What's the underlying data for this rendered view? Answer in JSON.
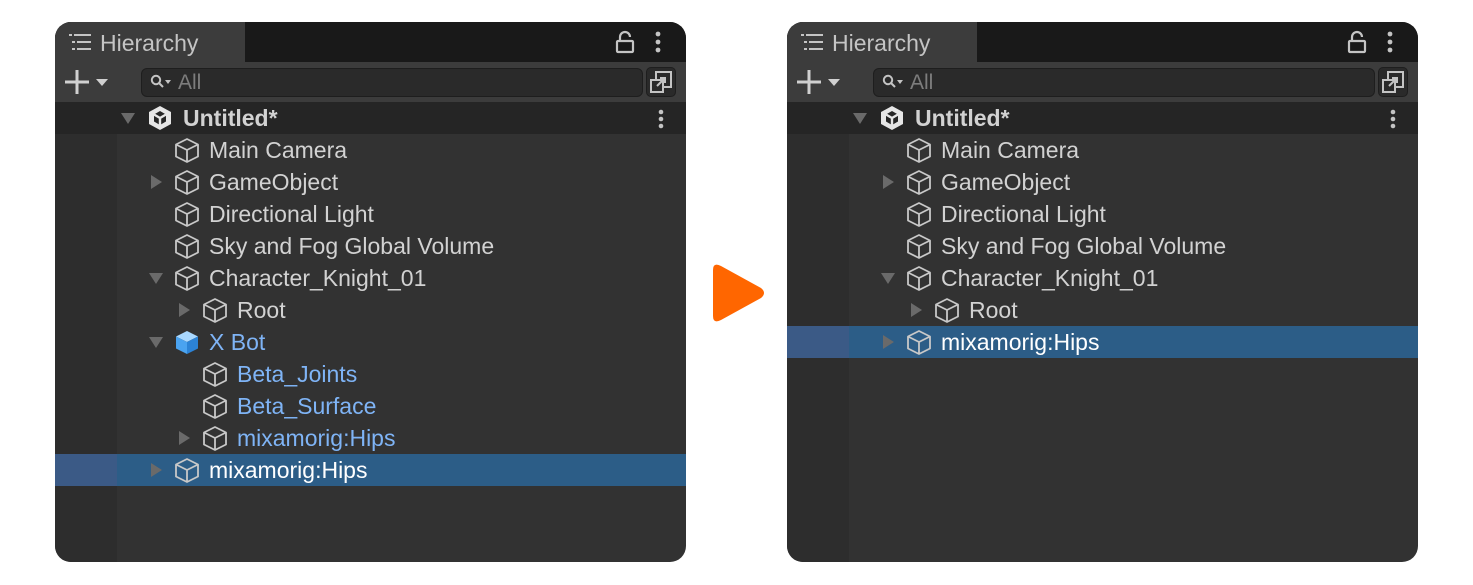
{
  "accent_color": "#ff6600",
  "selection_color": "#2c5d87",
  "prefab_text_color": "#7fb4f6",
  "panels": [
    {
      "tab_title": "Hierarchy",
      "search_placeholder": "All",
      "scene_name": "Untitled*",
      "rows": [
        {
          "label": "Main Camera",
          "icon": "cube-icon",
          "prefab": false,
          "fold": "none",
          "depth": 1,
          "selected": false
        },
        {
          "label": "GameObject",
          "icon": "cube-icon",
          "prefab": false,
          "fold": "collapsed",
          "depth": 1,
          "selected": false
        },
        {
          "label": "Directional Light",
          "icon": "cube-icon",
          "prefab": false,
          "fold": "none",
          "depth": 1,
          "selected": false
        },
        {
          "label": "Sky and Fog Global Volume",
          "icon": "cube-icon",
          "prefab": false,
          "fold": "none",
          "depth": 1,
          "selected": false
        },
        {
          "label": "Character_Knight_01",
          "icon": "cube-icon",
          "prefab": false,
          "fold": "expanded",
          "depth": 1,
          "selected": false
        },
        {
          "label": "Root",
          "icon": "cube-icon",
          "prefab": false,
          "fold": "collapsed",
          "depth": 2,
          "selected": false
        },
        {
          "label": "X Bot",
          "icon": "prefab-cube-icon",
          "prefab": true,
          "fold": "expanded",
          "depth": 1,
          "selected": false
        },
        {
          "label": "Beta_Joints",
          "icon": "cube-icon",
          "prefab": true,
          "fold": "none",
          "depth": 2,
          "selected": false
        },
        {
          "label": "Beta_Surface",
          "icon": "cube-icon",
          "prefab": true,
          "fold": "none",
          "depth": 2,
          "selected": false
        },
        {
          "label": "mixamorig:Hips",
          "icon": "cube-icon",
          "prefab": true,
          "fold": "collapsed",
          "depth": 2,
          "selected": false
        },
        {
          "label": "mixamorig:Hips",
          "icon": "cube-icon",
          "prefab": false,
          "fold": "collapsed",
          "depth": 1,
          "selected": true
        }
      ]
    },
    {
      "tab_title": "Hierarchy",
      "search_placeholder": "All",
      "scene_name": "Untitled*",
      "rows": [
        {
          "label": "Main Camera",
          "icon": "cube-icon",
          "prefab": false,
          "fold": "none",
          "depth": 1,
          "selected": false
        },
        {
          "label": "GameObject",
          "icon": "cube-icon",
          "prefab": false,
          "fold": "collapsed",
          "depth": 1,
          "selected": false
        },
        {
          "label": "Directional Light",
          "icon": "cube-icon",
          "prefab": false,
          "fold": "none",
          "depth": 1,
          "selected": false
        },
        {
          "label": "Sky and Fog Global Volume",
          "icon": "cube-icon",
          "prefab": false,
          "fold": "none",
          "depth": 1,
          "selected": false
        },
        {
          "label": "Character_Knight_01",
          "icon": "cube-icon",
          "prefab": false,
          "fold": "expanded",
          "depth": 1,
          "selected": false
        },
        {
          "label": "Root",
          "icon": "cube-icon",
          "prefab": false,
          "fold": "collapsed",
          "depth": 2,
          "selected": false
        },
        {
          "label": "mixamorig:Hips",
          "icon": "cube-icon",
          "prefab": false,
          "fold": "collapsed",
          "depth": 1,
          "selected": true
        }
      ]
    }
  ]
}
